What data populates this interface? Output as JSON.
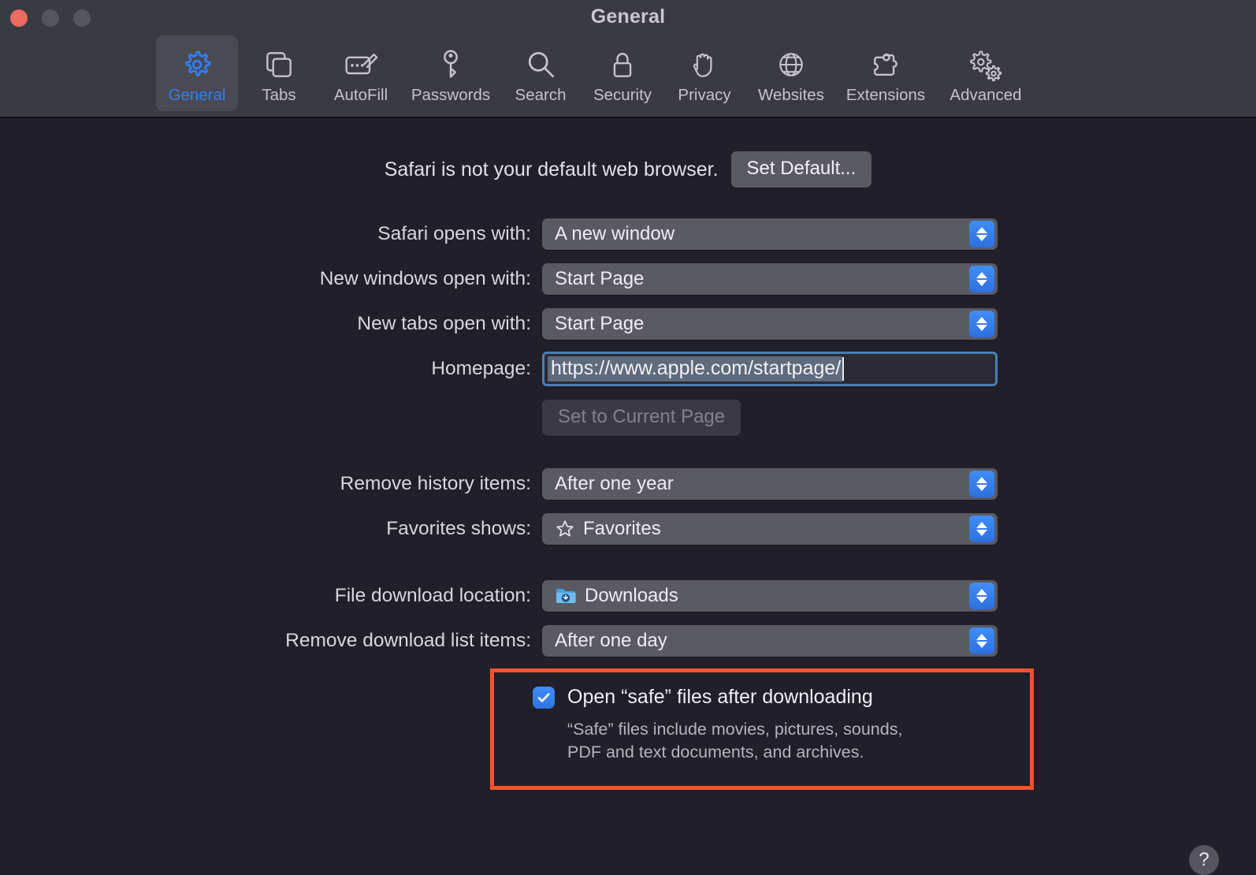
{
  "window": {
    "title": "General",
    "traffic_lights": [
      "close",
      "minimize",
      "maximize"
    ]
  },
  "toolbar": {
    "tabs": [
      {
        "id": "general",
        "label": "General",
        "icon": "gear-icon",
        "active": true
      },
      {
        "id": "tabs",
        "label": "Tabs",
        "icon": "tabs-icon",
        "active": false
      },
      {
        "id": "autofill",
        "label": "AutoFill",
        "icon": "autofill-icon",
        "active": false
      },
      {
        "id": "passwords",
        "label": "Passwords",
        "icon": "key-icon",
        "active": false
      },
      {
        "id": "search",
        "label": "Search",
        "icon": "magnifier-icon",
        "active": false
      },
      {
        "id": "security",
        "label": "Security",
        "icon": "lock-icon",
        "active": false
      },
      {
        "id": "privacy",
        "label": "Privacy",
        "icon": "hand-icon",
        "active": false
      },
      {
        "id": "websites",
        "label": "Websites",
        "icon": "globe-icon",
        "active": false
      },
      {
        "id": "extensions",
        "label": "Extensions",
        "icon": "puzzle-icon",
        "active": false
      },
      {
        "id": "advanced",
        "label": "Advanced",
        "icon": "gears-icon",
        "active": false
      }
    ]
  },
  "main": {
    "default_browser": {
      "notice": "Safari is not your default web browser.",
      "button_label": "Set Default..."
    },
    "safari_opens_with": {
      "label": "Safari opens with:",
      "value": "A new window"
    },
    "new_windows_open_with": {
      "label": "New windows open with:",
      "value": "Start Page"
    },
    "new_tabs_open_with": {
      "label": "New tabs open with:",
      "value": "Start Page"
    },
    "homepage": {
      "label": "Homepage:",
      "value": "https://www.apple.com/startpage/",
      "set_current_label": "Set to Current Page",
      "set_current_disabled": true,
      "selected": true
    },
    "remove_history_items": {
      "label": "Remove history items:",
      "value": "After one year"
    },
    "favorites_shows": {
      "label": "Favorites shows:",
      "value": "Favorites",
      "icon": "star-icon"
    },
    "file_download_location": {
      "label": "File download location:",
      "value": "Downloads",
      "icon": "downloads-folder-icon"
    },
    "remove_download_list_items": {
      "label": "Remove download list items:",
      "value": "After one day"
    },
    "open_safe_files": {
      "label": "Open “safe” files after downloading",
      "checked": true,
      "description_line1": "“Safe” files include movies, pictures, sounds,",
      "description_line2": "PDF and text documents, and archives."
    },
    "help_label": "?"
  },
  "colors": {
    "toolbar_bg": "#3a3a42",
    "content_bg": "#211f29",
    "accent_blue": "#2f80f5",
    "popup_bg": "#5a5a63",
    "highlight_red": "#f6512c",
    "selection_bg": "#5f6a7c",
    "focus_ring": "#4a7fb5"
  }
}
